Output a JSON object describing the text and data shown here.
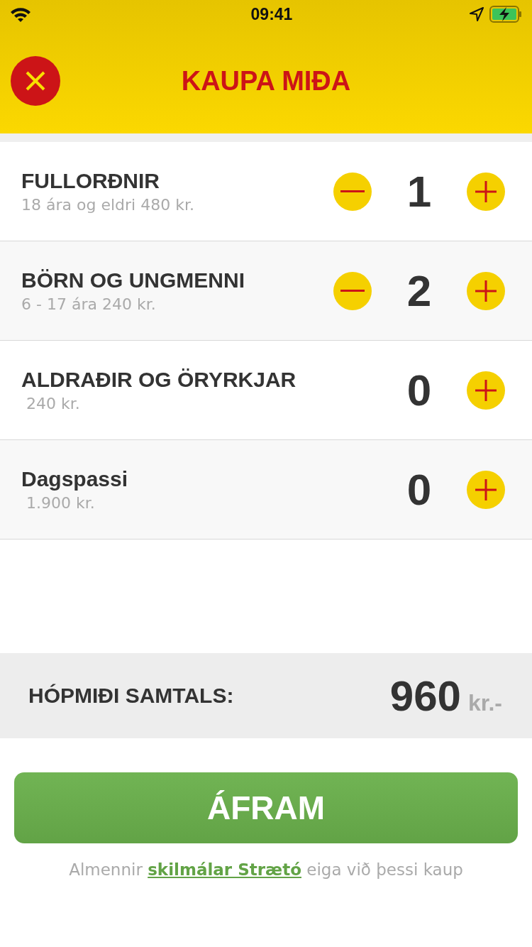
{
  "status_bar": {
    "time": "09:41"
  },
  "header": {
    "title": "KAUPA MIÐA"
  },
  "tickets": [
    {
      "name": "FULLORÐNIR",
      "detail": "18 ára og eldri 480 kr.",
      "count": "1",
      "can_decrease": true
    },
    {
      "name": "BÖRN OG UNGMENNI",
      "detail": "6 - 17 ára 240 kr.",
      "count": "2",
      "can_decrease": true
    },
    {
      "name": "ALDRAÐIR OG ÖRYRKJAR",
      "detail": " 240 kr.",
      "count": "0",
      "can_decrease": false
    },
    {
      "name": "Dagspassi",
      "detail": " 1.900 kr.",
      "count": "0",
      "can_decrease": false
    }
  ],
  "summary": {
    "label": "HÓPMIÐI SAMTALS:",
    "amount": "960",
    "unit": "kr.-"
  },
  "continue_button": {
    "label": "ÁFRAM"
  },
  "terms": {
    "before": "Almennir ",
    "link": "skilmálar Strætó",
    "after": " eiga við þessi kaup"
  }
}
